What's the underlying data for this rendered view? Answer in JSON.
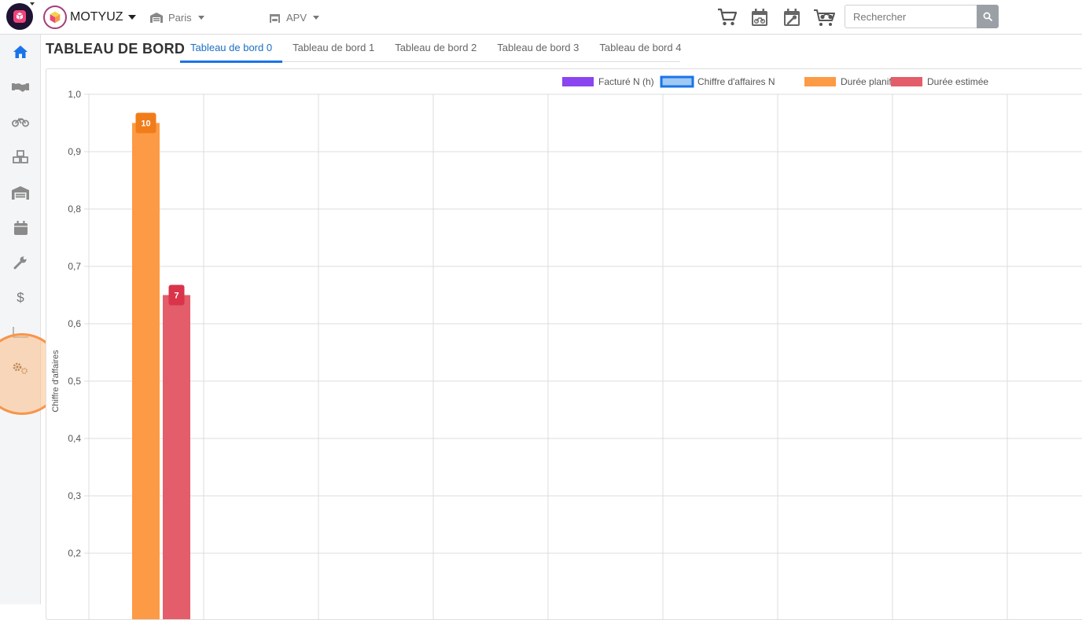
{
  "topbar": {
    "brand_name": "MOTYUZ",
    "site_selector": "Paris",
    "module_selector": "APV",
    "search": {
      "placeholder": "Rechercher"
    },
    "icons": [
      "cart-icon",
      "calendar-moto-icon",
      "calendar-wrench-icon",
      "cart-moto-icon",
      "search-icon"
    ]
  },
  "sidebar": {
    "items": [
      "home-icon",
      "handshake-icon",
      "motorcycle-icon",
      "cubes-icon",
      "warehouse-icon",
      "calendar-icon",
      "wrench-icon",
      "dollar-icon",
      "chart-icon",
      "cogs-icon"
    ],
    "active": "home-icon",
    "dollar_label": "$"
  },
  "page": {
    "title": "TABLEAU DE BORD",
    "tabs": [
      {
        "label": "Tableau de bord 0",
        "active": true
      },
      {
        "label": "Tableau de bord 1",
        "active": false
      },
      {
        "label": "Tableau de bord 2",
        "active": false
      },
      {
        "label": "Tableau de bord 3",
        "active": false
      },
      {
        "label": "Tableau de bord 4",
        "active": false
      }
    ]
  },
  "chart_data": {
    "type": "bar",
    "ylabel": "Chiffre d'affaires",
    "ylim": [
      0,
      1.0
    ],
    "y_visible_min": 0.1,
    "yticks": [
      "1,0",
      "0,9",
      "0,8",
      "0,7",
      "0,6",
      "0,5",
      "0,4",
      "0,3",
      "0,2"
    ],
    "ytick_values": [
      1.0,
      0.9,
      0.8,
      0.7,
      0.6,
      0.5,
      0.4,
      0.3,
      0.2
    ],
    "category_count": 9,
    "grid": true,
    "legend_position": "top-right",
    "series": [
      {
        "name": "Facturé N (h)",
        "color": "#8b45f0",
        "values": []
      },
      {
        "name": "Chiffre d'affaires N",
        "color": "#9fc9f3",
        "border": "#1a73e8",
        "values": []
      },
      {
        "name": "Durée planifiée",
        "color": "#fd9a45",
        "values": [
          0.95
        ],
        "labels": [
          "10"
        ],
        "label_color": "#f07d1a"
      },
      {
        "name": "Durée estimée",
        "color": "#e35d6a",
        "values": [
          0.65
        ],
        "labels": [
          "7"
        ],
        "label_color": "#d9344a"
      }
    ]
  }
}
